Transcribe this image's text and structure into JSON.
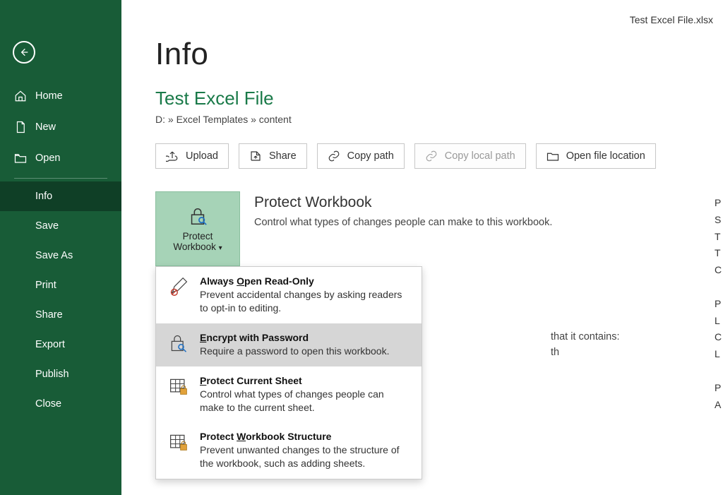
{
  "filename": "Test Excel File.xlsx",
  "sidebar": {
    "home": "Home",
    "new": "New",
    "open": "Open",
    "info": "Info",
    "save": "Save",
    "saveAs": "Save As",
    "print": "Print",
    "share": "Share",
    "export": "Export",
    "publish": "Publish",
    "close": "Close"
  },
  "page": {
    "heading": "Info",
    "docTitle": "Test Excel File",
    "breadcrumb": "D: » Excel Templates » content"
  },
  "actions": {
    "upload": "Upload",
    "share": "Share",
    "copyPath": "Copy path",
    "copyLocalPath": "Copy local path",
    "openLocation": "Open file location"
  },
  "protect": {
    "buttonLine1": "Protect",
    "buttonLine2": "Workbook",
    "title": "Protect Workbook",
    "desc": "Control what types of changes people can make to this workbook.",
    "behindText1": "that it contains:",
    "behindText2": "th"
  },
  "menu": {
    "readOnly": {
      "prefix": "Always ",
      "key": "O",
      "suffix": "pen Read-Only",
      "desc": "Prevent accidental changes by asking readers to opt-in to editing."
    },
    "encrypt": {
      "key": "E",
      "suffix": "ncrypt with Password",
      "desc": "Require a password to open this workbook."
    },
    "sheet": {
      "key": "P",
      "suffix": "rotect Current Sheet",
      "desc": "Control what types of changes people can make to the current sheet."
    },
    "structure": {
      "prefix": "Protect ",
      "key": "W",
      "suffix": "orkbook Structure",
      "desc": "Prevent unwanted changes to the structure of the workbook, such as adding sheets."
    }
  },
  "rightPeek": [
    "P",
    "S",
    "T",
    "T",
    "C",
    "",
    "P",
    "L",
    "C",
    "L",
    "",
    "P",
    "A"
  ]
}
